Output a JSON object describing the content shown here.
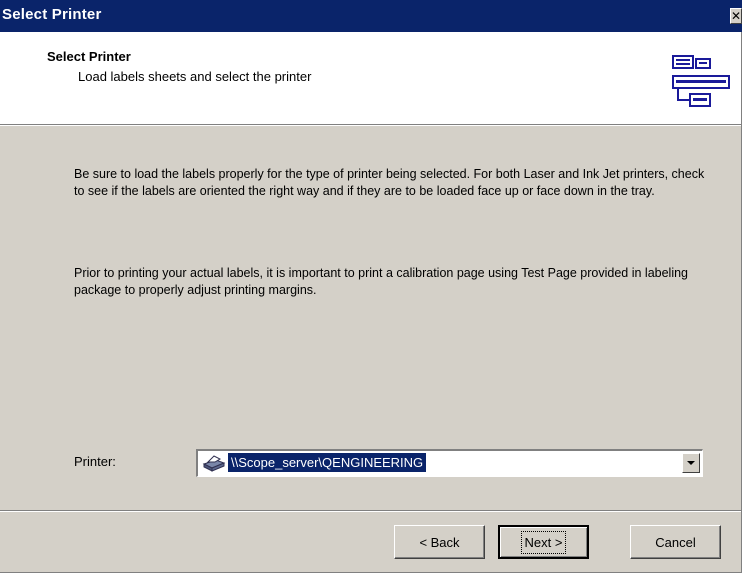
{
  "window": {
    "title": "Select Printer",
    "close_glyph": "✕"
  },
  "header": {
    "title": "Select Printer",
    "subtitle": "Load labels sheets and select the printer",
    "logo_icon": "label-tags-icon"
  },
  "content": {
    "paragraph1": "Be sure to load the labels properly for the type of printer being selected.  For both Laser and Ink Jet printers, check to see if the labels are oriented the right way and if they are to be loaded face up or face down in the tray.",
    "paragraph2": "Prior to printing your actual labels, it is important to print a calibration page using Test Page provided in labeling package to properly adjust printing margins."
  },
  "printer": {
    "label": "Printer:",
    "value": "\\\\Scope_server\\QENGINEERING",
    "icon": "printer-icon"
  },
  "buttons": {
    "back": "< Back",
    "next": "Next >",
    "cancel": "Cancel"
  },
  "colors": {
    "titlebar": "#0a246a",
    "face": "#d4d0c8",
    "selection": "#0a246a"
  }
}
